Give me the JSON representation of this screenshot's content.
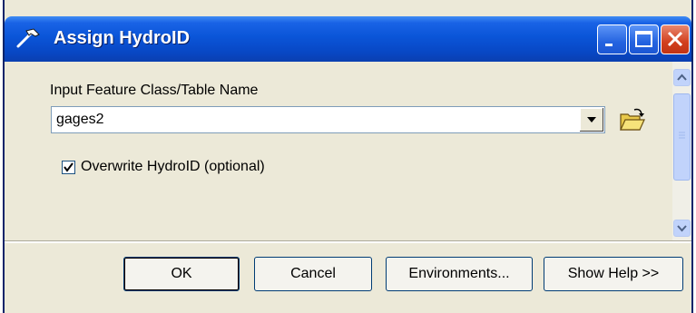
{
  "window": {
    "title": "Assign HydroID",
    "controls": {
      "minimize": "minimize-icon",
      "maximize": "maximize-icon",
      "close": "close-icon"
    }
  },
  "form": {
    "input_label": "Input Feature Class/Table Name",
    "input_value": "gages2",
    "browse_icon": "open-folder-icon",
    "checkbox_label": "Overwrite HydroID (optional)",
    "checkbox_checked": true
  },
  "buttons": {
    "ok": "OK",
    "cancel": "Cancel",
    "environments": "Environments...",
    "show_help": "Show Help >>"
  },
  "colors": {
    "titlebar": "#0a55d8",
    "dialog_bg": "#ece9d8",
    "close_button": "#d2401e"
  }
}
